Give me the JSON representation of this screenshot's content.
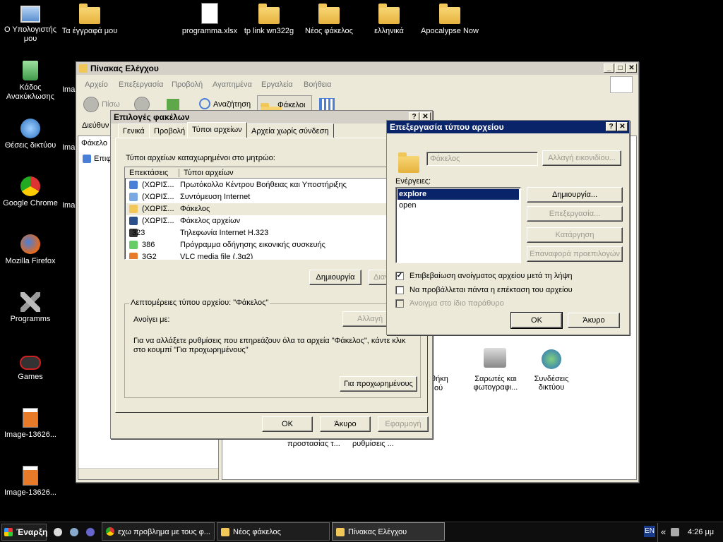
{
  "desktop": {
    "icons": [
      {
        "label": "Ο Υπολογιστής μου",
        "icon": "computer-icon"
      },
      {
        "label": "Τα έγγραφά μου",
        "icon": "documents-icon"
      },
      {
        "label": "programma.xlsx",
        "icon": "excel-file-icon"
      },
      {
        "label": "tp link wn322g",
        "icon": "folder-icon"
      },
      {
        "label": "Νέος φάκελος",
        "icon": "folder-icon"
      },
      {
        "label": "ελληνικά",
        "icon": "folder-icon"
      },
      {
        "label": "Apocalypse Now",
        "icon": "folder-icon"
      },
      {
        "label": "Κάδος Ανακύκλωσης",
        "icon": "recycle-bin-icon"
      },
      {
        "label": "Θέσεις δικτύου",
        "icon": "network-icon"
      },
      {
        "label": "Google Chrome",
        "icon": "chrome-icon"
      },
      {
        "label": "Mozilla Firefox",
        "icon": "firefox-icon"
      },
      {
        "label": "Programms",
        "icon": "tools-icon"
      },
      {
        "label": "Games",
        "icon": "gamepad-icon"
      },
      {
        "label": "Image-13626...",
        "icon": "image-icon"
      },
      {
        "label": "Image-13626...",
        "icon": "image-icon"
      }
    ],
    "partial_labels": [
      "Ima",
      "Ima",
      "Ima"
    ]
  },
  "control_panel": {
    "title": "Πίνακας Ελέγχου",
    "menu": [
      "Αρχείο",
      "Επεξεργασία",
      "Προβολή",
      "Αγαπημένα",
      "Εργαλεία",
      "Βοήθεια"
    ],
    "toolbar": {
      "back": "Πίσω",
      "search": "Αναζήτηση",
      "folders": "Φάκελοι"
    },
    "address_label": "Διεύθυν",
    "sidebar_label": "Φάκελο",
    "tree_first": "Επιφ",
    "items": [
      {
        "label": "Σαρωτές και φωτογραφι...",
        "icon": "scanner-icon"
      },
      {
        "label": "Συνδέσεις δικτύου",
        "icon": "network-connections-icon"
      }
    ],
    "partial_items": [
      "θήκη",
      "ού",
      "προστασίας τ...",
      "ρυθμίσεις ..."
    ]
  },
  "folder_options": {
    "title": "Επιλογές φακέλων",
    "tabs": [
      "Γενικά",
      "Προβολή",
      "Τύποι αρχείων",
      "Αρχεία χωρίς σύνδεση"
    ],
    "registered_label": "Τύποι αρχείων καταχωρημένοι στο μητρώο:",
    "columns": [
      "Επεκτάσεις",
      "Τύποι αρχείων"
    ],
    "rows": [
      {
        "ext": "(ΧΩΡΙΣ...",
        "type": "Πρωτόκολλο Κέντρου Βοήθειας και Υποστήριξης"
      },
      {
        "ext": "(ΧΩΡΙΣ...",
        "type": "Συντόμευση Internet"
      },
      {
        "ext": "(ΧΩΡΙΣ...",
        "type": "Φάκελος"
      },
      {
        "ext": "(ΧΩΡΙΣ...",
        "type": "Φάκελος αρχείων"
      },
      {
        "ext": "323",
        "type": "Τηλεφωνία Internet H.323"
      },
      {
        "ext": "386",
        "type": "Πρόγραμμα οδήγησης εικονικής συσκευής"
      },
      {
        "ext": "3G2",
        "type": "VLC media file (.3g2)"
      }
    ],
    "create_btn": "Δημιουργία",
    "delete_btn_partial": "Διαγ",
    "details_group": "Λεπτομέρειες τύπου αρχείου: \"Φάκελος\"",
    "opens_with": "Ανοίγει με:",
    "change_btn_partial": "Αλλαγή",
    "details_text": "Για να αλλάξετε ρυθμίσεις που επηρεάζουν όλα τα αρχεία \"Φάκελος\", κάντε κλικ στο κουμπί \"Για προχωρημένους\"",
    "advanced_btn": "Για προχωρημένους",
    "ok": "OK",
    "cancel": "Άκυρο",
    "apply": "Εφαρμογή"
  },
  "edit_type": {
    "title": "Επεξεργασία τύπου αρχείου",
    "name_value": "Φάκελος",
    "change_icon": "Αλλαγή εικονιδίου...",
    "actions_label": "Ενέργειες:",
    "actions": [
      "explore",
      "open"
    ],
    "new_btn": "Δημιουργία...",
    "edit_btn": "Επεξεργασία...",
    "remove_btn": "Κατάργηση",
    "default_btn": "Επαναφορά προεπιλογών",
    "checks": [
      {
        "label": "Επιβεβαίωση ανοίγματος αρχείου μετά τη λήψη",
        "checked": true,
        "enabled": true
      },
      {
        "label": "Να προβάλλεται πάντα η επέκταση του αρχείου",
        "checked": false,
        "enabled": true
      },
      {
        "label": "Άνοιγμα στο ίδιο παράθυρο",
        "checked": false,
        "enabled": false
      }
    ],
    "ok": "OK",
    "cancel": "Άκυρο"
  },
  "taskbar": {
    "start": "Έναρξη",
    "items": [
      "εχω προβλημα με τους φ...",
      "Νέος φάκελος",
      "Πίνακας Ελέγχου"
    ],
    "lang": "EN",
    "chevron": "«",
    "clock": "4:26 μμ"
  }
}
